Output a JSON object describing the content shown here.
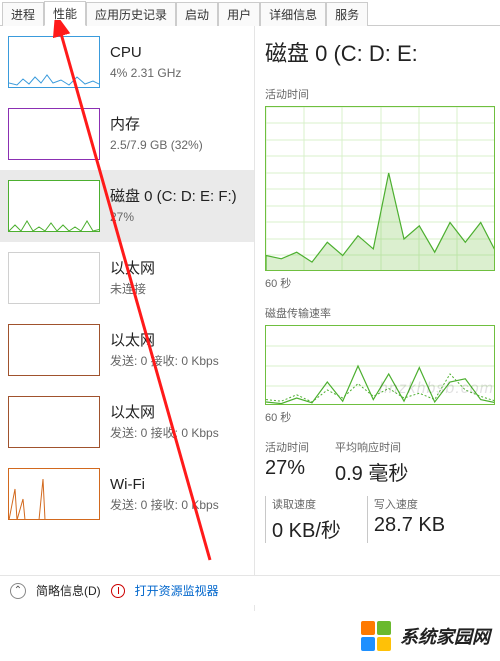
{
  "tabs": {
    "items": [
      {
        "label": "进程"
      },
      {
        "label": "性能"
      },
      {
        "label": "应用历史记录"
      },
      {
        "label": "启动"
      },
      {
        "label": "用户"
      },
      {
        "label": "详细信息"
      },
      {
        "label": "服务"
      }
    ],
    "active_index": 1
  },
  "sidebar": {
    "items": [
      {
        "title": "CPU",
        "sub": "4% 2.31 GHz",
        "color": "#3a9bdc"
      },
      {
        "title": "内存",
        "sub": "2.5/7.9 GB (32%)",
        "color": "#8b2fb3"
      },
      {
        "title": "磁盘 0 (C: D: E: F:)",
        "sub": "27%",
        "color": "#4caf2f"
      },
      {
        "title": "以太网",
        "sub": "未连接",
        "color": "#bdbdbd"
      },
      {
        "title": "以太网",
        "sub": "发送: 0 接收: 0 Kbps",
        "color": "#a0522d"
      },
      {
        "title": "以太网",
        "sub": "发送: 0 接收: 0 Kbps",
        "color": "#a0522d"
      },
      {
        "title": "Wi-Fi",
        "sub": "发送: 0 接收: 0 Kbps",
        "color": "#d2691e"
      }
    ],
    "selected_index": 2
  },
  "detail": {
    "title": "磁盘 0 (C: D: E:",
    "section1_label": "活动时间",
    "axis1": "60 秒",
    "section2_label": "磁盘传输速率",
    "axis2": "60 秒",
    "stats_top": [
      {
        "label": "活动时间",
        "value": "27%"
      },
      {
        "label": "平均响应时间",
        "value": "0.9 毫秒"
      }
    ],
    "stats_bottom": [
      {
        "label": "读取速度",
        "value": "0 KB/秒"
      },
      {
        "label": "写入速度",
        "value": "28.7 KB"
      }
    ]
  },
  "bottom": {
    "fewer": "简略信息(D)",
    "monitor": "打开资源监视器"
  },
  "branding": {
    "watermark": "hnzkhbsb.com",
    "site": "系统家园网",
    "colors": [
      "#ff7a00",
      "#6ab92e",
      "#1e90ff",
      "#ffc107"
    ]
  },
  "chart_data": [
    {
      "type": "line",
      "title": "活动时间",
      "xlabel": "60 秒",
      "ylabel": "%",
      "ylim": [
        0,
        100
      ],
      "x_seconds_ago": [
        60,
        56,
        52,
        48,
        44,
        40,
        36,
        32,
        28,
        24,
        20,
        16,
        12,
        8,
        4,
        0
      ],
      "series": [
        {
          "name": "活动时间 %",
          "values": [
            10,
            8,
            12,
            6,
            18,
            10,
            22,
            14,
            60,
            20,
            28,
            12,
            30,
            18,
            30,
            12
          ]
        }
      ]
    },
    {
      "type": "line",
      "title": "磁盘传输速率",
      "xlabel": "60 秒",
      "ylabel": "KB/秒",
      "ylim": [
        0,
        100
      ],
      "x_seconds_ago": [
        60,
        56,
        52,
        48,
        44,
        40,
        36,
        32,
        28,
        24,
        20,
        16,
        12,
        8,
        4,
        0
      ],
      "series": [
        {
          "name": "读取",
          "values": [
            5,
            3,
            10,
            4,
            30,
            6,
            50,
            8,
            40,
            6,
            48,
            5,
            30,
            34,
            8,
            4
          ]
        },
        {
          "name": "写入",
          "values": [
            8,
            6,
            14,
            5,
            20,
            10,
            28,
            12,
            22,
            10,
            16,
            8,
            40,
            20,
            12,
            6
          ]
        }
      ]
    }
  ]
}
